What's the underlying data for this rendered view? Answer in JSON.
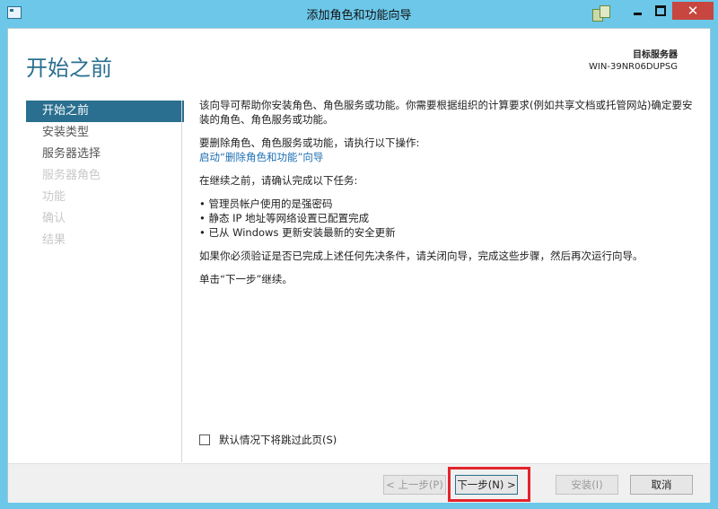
{
  "window": {
    "title": "添加角色和功能向导"
  },
  "header": {
    "page_title": "开始之前",
    "server_label": "目标服务器",
    "server_name": "WIN-39NR06DUPSG"
  },
  "nav": {
    "items": [
      {
        "label": "开始之前",
        "state": "active"
      },
      {
        "label": "安装类型",
        "state": "normal"
      },
      {
        "label": "服务器选择",
        "state": "normal"
      },
      {
        "label": "服务器角色",
        "state": "disabled"
      },
      {
        "label": "功能",
        "state": "disabled"
      },
      {
        "label": "确认",
        "state": "disabled"
      },
      {
        "label": "结果",
        "state": "disabled"
      }
    ]
  },
  "content": {
    "intro": "该向导可帮助你安装角色、角色服务或功能。你需要根据组织的计算要求(例如共享文档或托管网站)确定要安装的角色、角色服务或功能。",
    "remove_text": "要删除角色、角色服务或功能，请执行以下操作:",
    "remove_link": "启动“删除角色和功能”向导",
    "confirm_text": "在继续之前，请确认完成以下任务:",
    "bullets": [
      "管理员帐户使用的是强密码",
      "静态 IP 地址等网络设置已配置完成",
      "已从 Windows 更新安装最新的安全更新"
    ],
    "verify_text": "如果你必须验证是否已完成上述任何先决条件，请关闭向导，完成这些步骤，然后再次运行向导。",
    "click_next": "单击“下一步”继续。"
  },
  "skip_checkbox": {
    "label": "默认情况下将跳过此页(S)",
    "checked": false
  },
  "footer": {
    "prev": "< 上一步(P)",
    "next": "下一步(N) >",
    "install": "安装(I)",
    "cancel": "取消"
  },
  "colors": {
    "titlebar": "#6cc7e9",
    "accent": "#2a6f8f",
    "highlight": "#e3242b"
  }
}
